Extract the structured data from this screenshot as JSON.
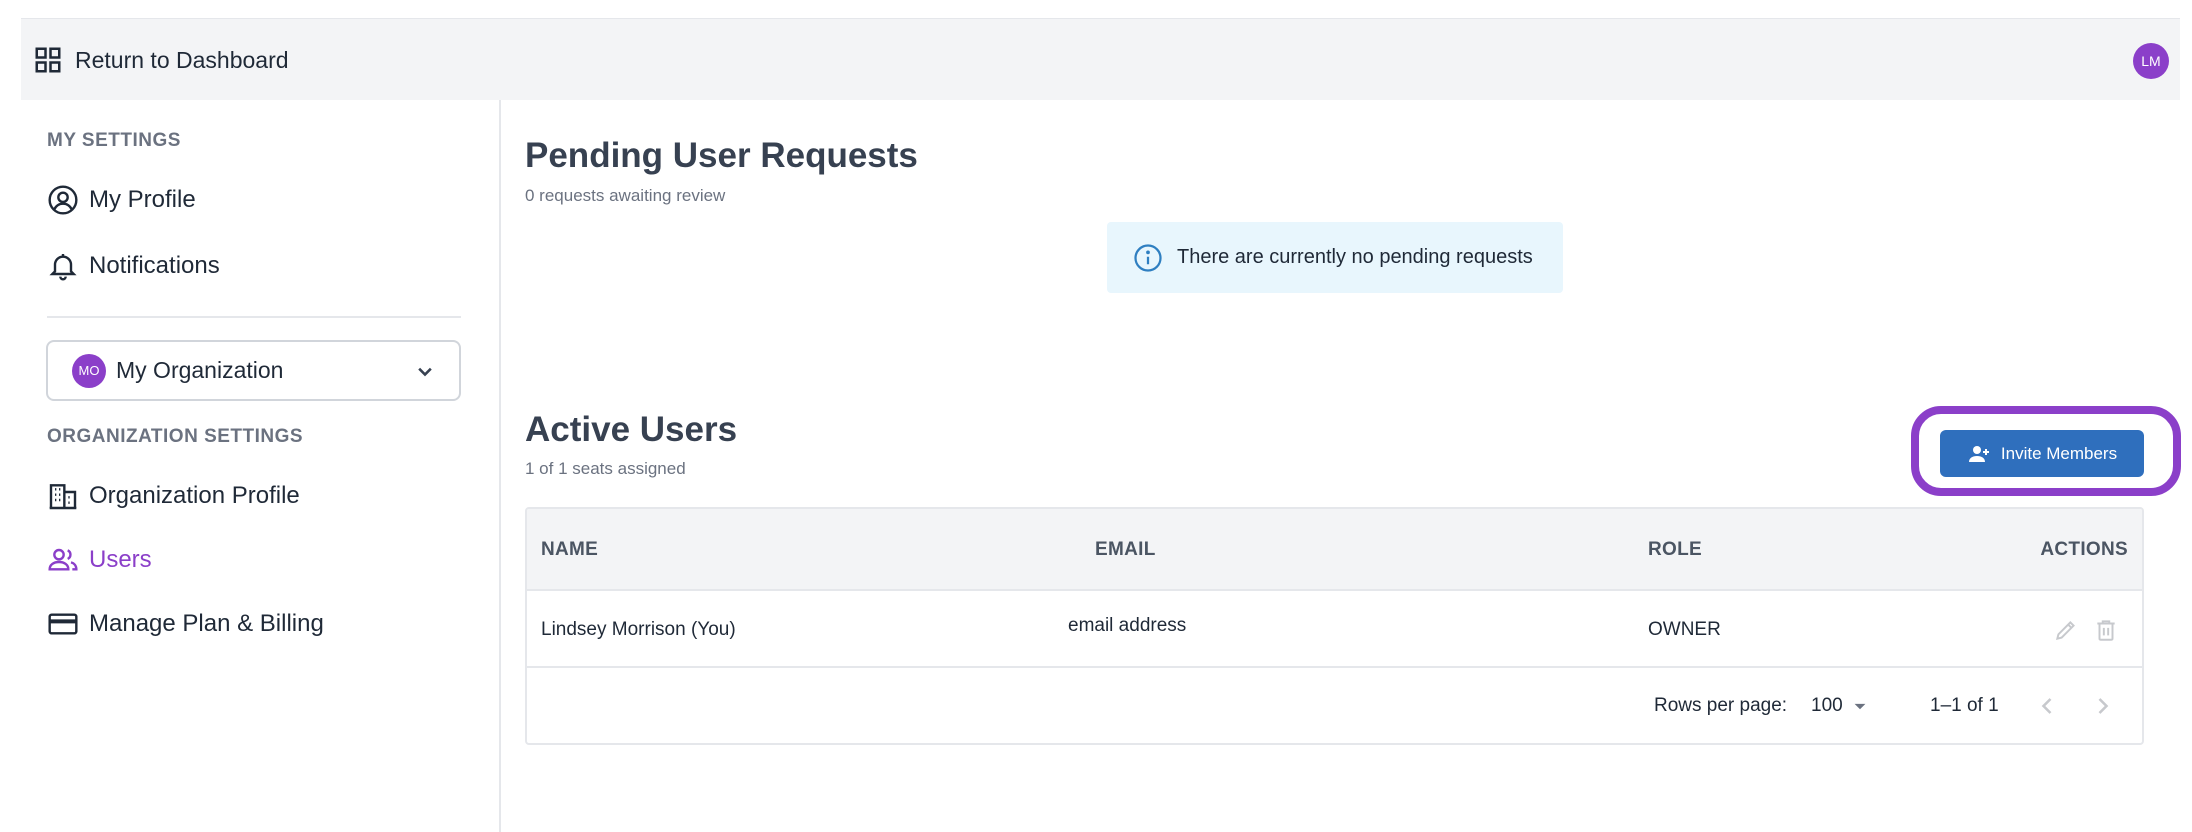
{
  "topbar": {
    "dashboard_label": "Return to Dashboard",
    "user_initials": "LM"
  },
  "sidebar": {
    "my_settings_title": "MY SETTINGS",
    "my_profile": "My Profile",
    "notifications": "Notifications",
    "org_initials": "MO",
    "org_name": "My Organization",
    "org_settings_title": "ORGANIZATION SETTINGS",
    "org_profile": "Organization Profile",
    "users": "Users",
    "billing": "Manage Plan & Billing"
  },
  "pending": {
    "title": "Pending User Requests",
    "subtitle": "0 requests awaiting review",
    "empty_message": "There are currently no pending requests"
  },
  "active": {
    "title": "Active Users",
    "subtitle": "1 of 1 seats assigned",
    "invite_label": "Invite Members"
  },
  "table": {
    "headers": {
      "name": "NAME",
      "email": "EMAIL",
      "role": "ROLE",
      "actions": "ACTIONS"
    },
    "rows": [
      {
        "name": "Lindsey Morrison (You)",
        "email": "email address",
        "role": "OWNER"
      }
    ],
    "footer": {
      "rows_per_page_label": "Rows per page:",
      "rows_per_page": "100",
      "range": "1–1 of 1"
    }
  },
  "colors": {
    "accent": "#8b3fc9",
    "primary": "#2f6fbd",
    "info_bg": "#e8f6fd"
  }
}
